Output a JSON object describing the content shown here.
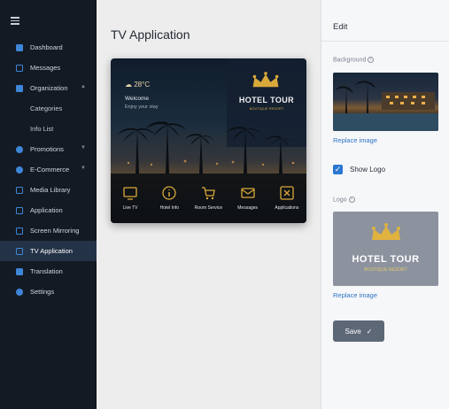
{
  "sidebar": {
    "items": [
      {
        "label": "Dashboard",
        "icon": "dashboard-icon",
        "name": "sidebar-item-dashboard"
      },
      {
        "label": "Messages",
        "icon": "messages-icon",
        "name": "sidebar-item-messages"
      },
      {
        "label": "Organization",
        "icon": "organization-icon",
        "name": "sidebar-item-organization",
        "expanded": true
      },
      {
        "label": "Categories",
        "sub": true,
        "name": "sidebar-item-categories"
      },
      {
        "label": "Info List",
        "sub": true,
        "name": "sidebar-item-info-list"
      },
      {
        "label": "Promotions",
        "icon": "promotions-icon",
        "name": "sidebar-item-promotions",
        "collapsed": true
      },
      {
        "label": "E-Commerce",
        "icon": "ecommerce-icon",
        "name": "sidebar-item-ecommerce",
        "collapsed": true
      },
      {
        "label": "Media Library",
        "icon": "media-library-icon",
        "name": "sidebar-item-media-library"
      },
      {
        "label": "Application",
        "icon": "application-icon",
        "name": "sidebar-item-application"
      },
      {
        "label": "Screen Mirroring",
        "icon": "screen-mirroring-icon",
        "name": "sidebar-item-screen-mirroring"
      },
      {
        "label": "TV Application",
        "icon": "tv-icon",
        "name": "sidebar-item-tv-application",
        "active": true
      },
      {
        "label": "Translation",
        "icon": "translation-icon",
        "name": "sidebar-item-translation"
      },
      {
        "label": "Settings",
        "icon": "settings-icon",
        "name": "sidebar-item-settings"
      }
    ]
  },
  "main": {
    "title": "TV Application",
    "preview": {
      "weather": "28°C",
      "welcome": "Welcome",
      "welcome_sub": "Enjoy your stay",
      "hotel_name": "HOTEL TOUR",
      "hotel_sub": "BOUTIQUE RESORT",
      "apps": [
        {
          "label": "Live TV",
          "icon": "live-tv-icon"
        },
        {
          "label": "Hotel Info",
          "icon": "info-icon"
        },
        {
          "label": "Room Service",
          "icon": "cart-icon"
        },
        {
          "label": "Messages",
          "icon": "mail-icon"
        },
        {
          "label": "Applications",
          "icon": "applications-icon"
        }
      ]
    }
  },
  "edit": {
    "title": "Edit",
    "background_label": "Background",
    "replace_background": "Replace image",
    "show_logo_label": "Show Logo",
    "show_logo_checked": true,
    "logo_label": "Logo",
    "logo_hotel_name": "HOTEL TOUR",
    "logo_hotel_sub": "BOUTIQUE RESORT",
    "replace_logo": "Replace image",
    "save_label": "Save",
    "checkmark": "✓",
    "info_glyph": "i"
  },
  "colors": {
    "sidebar_bg": "#141a23",
    "active_bg": "#243247",
    "accent": "#2b77d0",
    "gold": "#d9a93a"
  }
}
